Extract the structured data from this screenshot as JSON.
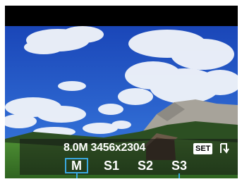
{
  "osd": {
    "megapixels": "8.0M",
    "resolution": "3456x2304",
    "set_label": "SET",
    "share_icon": "return-arrow-icon"
  },
  "quality_options": [
    {
      "label": "M",
      "selected": true
    },
    {
      "label": "S1",
      "selected": false
    },
    {
      "label": "S2",
      "selected": false
    },
    {
      "label": "S3",
      "selected": false
    }
  ],
  "colors": {
    "accent": "#3aa9e0",
    "sky": "#1d50c4",
    "grass": "#3f7d2a"
  }
}
